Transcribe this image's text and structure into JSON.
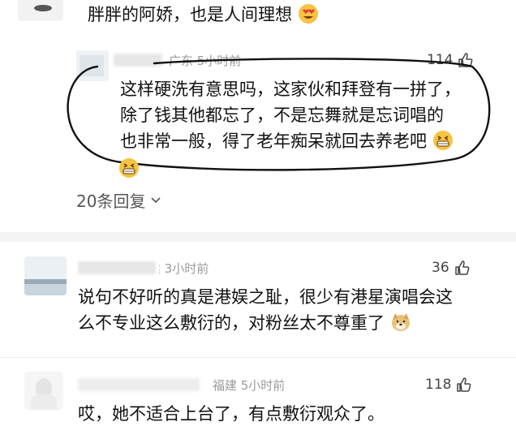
{
  "comments": [
    {
      "text": "胖胖的阿娇，也是人间理想"
    },
    {
      "location_time": "广东 5小时前",
      "likes": "114",
      "lines": [
        "这样硬洗有意思吗，这家伙和拜登有一拼了，",
        "除了钱其他都忘了，不是忘舞就是忘词唱的",
        "也非常一般，得了老年痴呆就回去养老吧"
      ],
      "replies_label": "20条回复"
    },
    {
      "location_time": "福建 3小时前",
      "likes": "36",
      "lines": [
        "说句不好听的真是港娱之耻，很少有港星演唱会这",
        "么不专业这么敷衍的，对粉丝太不尊重了"
      ]
    },
    {
      "location_time": "福建 5小时前",
      "likes": "118",
      "lines": [
        "哎，她不适合上台了，有点敷衍观众了。"
      ]
    }
  ],
  "icons": {
    "like": "thumbs-up-icon",
    "love_emoji": "heart-eyes-emoji-icon",
    "grin_emoji": "grinning-emoji-icon",
    "doge_emoji": "doge-emoji-icon",
    "chevron": "chevron-down-icon"
  },
  "colors": {
    "circle_annotation": "#111111",
    "meta_text": "#9a9a9a",
    "accent_emoji": "#f6c342"
  }
}
